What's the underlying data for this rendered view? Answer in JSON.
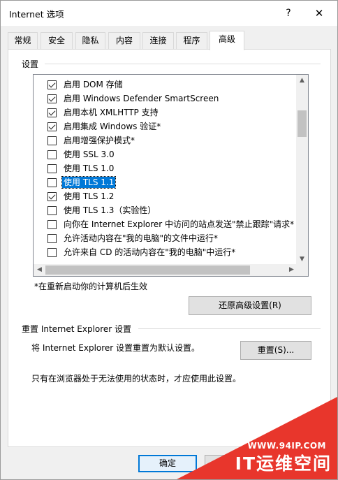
{
  "window": {
    "title": "Internet 选项",
    "help_glyph": "?",
    "close_glyph": "✕"
  },
  "tabs": [
    {
      "label": "常规",
      "active": false
    },
    {
      "label": "安全",
      "active": false
    },
    {
      "label": "隐私",
      "active": false
    },
    {
      "label": "内容",
      "active": false
    },
    {
      "label": "连接",
      "active": false
    },
    {
      "label": "程序",
      "active": false
    },
    {
      "label": "高级",
      "active": true
    }
  ],
  "settings": {
    "group_label": "设置",
    "items": [
      {
        "label": "启用 DOM 存储",
        "checked": true,
        "selected": false
      },
      {
        "label": "启用 Windows Defender SmartScreen",
        "checked": true,
        "selected": false
      },
      {
        "label": "启用本机 XMLHTTP 支持",
        "checked": true,
        "selected": false
      },
      {
        "label": "启用集成 Windows 验证*",
        "checked": true,
        "selected": false
      },
      {
        "label": "启用增强保护模式*",
        "checked": false,
        "selected": false
      },
      {
        "label": "使用 SSL 3.0",
        "checked": false,
        "selected": false
      },
      {
        "label": "使用 TLS 1.0",
        "checked": false,
        "selected": false
      },
      {
        "label": "使用 TLS 1.1",
        "checked": false,
        "selected": true
      },
      {
        "label": "使用 TLS 1.2",
        "checked": true,
        "selected": false
      },
      {
        "label": "使用 TLS 1.3（实验性）",
        "checked": false,
        "selected": false
      },
      {
        "label": "向你在 Internet Explorer 中访问的站点发送\"禁止跟踪\"请求*",
        "checked": false,
        "selected": false
      },
      {
        "label": "允许活动内容在\"我的电脑\"的文件中运行*",
        "checked": false,
        "selected": false
      },
      {
        "label": "允许来自 CD 的活动内容在\"我的电脑\"中运行*",
        "checked": false,
        "selected": false
      }
    ],
    "restart_note": "*在重新启动你的计算机后生效",
    "restore_button": "还原高级设置(R)"
  },
  "reset": {
    "group_label": "重置 Internet Explorer 设置",
    "description": "将 Internet Explorer 设置重置为默认设置。",
    "button": "重置(S)...",
    "warning": "只有在浏览器处于无法使用的状态时，才应使用此设置。"
  },
  "footer": {
    "ok_button": "确定"
  },
  "watermark": {
    "url": "WWW.94IP.COM",
    "brand": "IT运维空间"
  }
}
